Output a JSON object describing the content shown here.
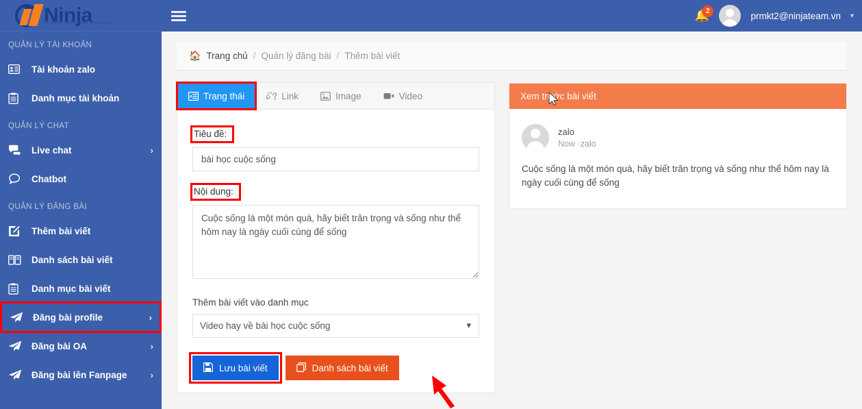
{
  "brand": {
    "name": "Ninja",
    "tagline": "Hệ thống phần mềm Marketing"
  },
  "topbar": {
    "menu_icon": "hamburger-icon",
    "notification_count": "2",
    "user_email": "prmkt2@ninjateam.vn",
    "caret_icon": "chevron-down-icon"
  },
  "sidebar": {
    "sections": [
      {
        "title": "QUẢN LÝ TÀI KHOẢN",
        "items": [
          {
            "label": "Tài khoản zalo",
            "icon": "id-card-icon",
            "chevron": ""
          },
          {
            "label": "Danh mục tài khoản",
            "icon": "clipboard-icon",
            "chevron": ""
          }
        ]
      },
      {
        "title": "QUẢN LÝ CHAT",
        "items": [
          {
            "label": "Live chat",
            "icon": "chat-bubbles-icon",
            "chevron": "›"
          },
          {
            "label": "Chatbot",
            "icon": "chat-bubble-icon",
            "chevron": ""
          }
        ]
      },
      {
        "title": "QUẢN LÝ ĐĂNG BÀI",
        "items": [
          {
            "label": "Thêm bài viết",
            "icon": "pencil-square-icon",
            "chevron": ""
          },
          {
            "label": "Danh sách bài viết",
            "icon": "book-icon",
            "chevron": ""
          },
          {
            "label": "Danh mục bài viết",
            "icon": "clipboard-icon",
            "chevron": ""
          },
          {
            "label": "Đăng bài profile",
            "icon": "paper-plane-icon",
            "chevron": "›",
            "highlighted": true
          },
          {
            "label": "Đăng bài OA",
            "icon": "paper-plane-icon",
            "chevron": "›"
          },
          {
            "label": "Đăng bài lên Fanpage",
            "icon": "paper-plane-icon",
            "chevron": "›"
          }
        ]
      }
    ]
  },
  "breadcrumb": {
    "home_icon": "home-icon",
    "items": [
      "Trang chủ",
      "Quản lý đăng bài",
      "Thêm bài viết"
    ],
    "separator": "/"
  },
  "editor": {
    "tabs": [
      {
        "label": "Trạng thái",
        "icon": "list-indent-icon",
        "active": true
      },
      {
        "label": "Link",
        "icon": "broken-link-icon",
        "active": false
      },
      {
        "label": "Image",
        "icon": "image-icon",
        "active": false
      },
      {
        "label": "Video",
        "icon": "video-camera-icon",
        "active": false
      }
    ],
    "title_label": "Tiêu đề:",
    "title_value": "bài học cuộc sống",
    "title_placeholder": "",
    "content_label": "Nội dung:",
    "content_value": "Cuộc sống là một món quà, hãy biết trân trọng và sống như thể hôm nay là ngày cuối cùng để sống",
    "content_placeholder": "",
    "category_label": "Thêm bài viết vào danh mục",
    "category_selected": "Video hay về bài học cuộc sống",
    "category_options": [
      "Video hay về bài học cuộc sống"
    ],
    "select_chevron_icon": "chevron-down-icon",
    "save_button": "Lưu bài viết",
    "save_icon": "floppy-disk-icon",
    "list_button": "Danh sách bài viết",
    "list_icon": "copy-icon"
  },
  "preview": {
    "header": "Xem trước bài viết",
    "avatar_icon": "user-avatar-icon",
    "author": "zalo",
    "meta": "Now ·zalo",
    "text": "Cuộc sống là một món quà, hãy biết trân trọng và sống như thể hôm nay là ngày cuối cùng để sống"
  },
  "colors": {
    "sidebar_blue": "#3c5fab",
    "logo_navy": "#1b3e8c",
    "logo_orange": "#f58220",
    "active_tab_blue": "#2196f3",
    "save_blue": "#1565d8",
    "list_orange": "#e8511d",
    "preview_orange": "#f47b4a",
    "highlight_red": "#ff0000",
    "badge_orange": "#f4511e"
  }
}
